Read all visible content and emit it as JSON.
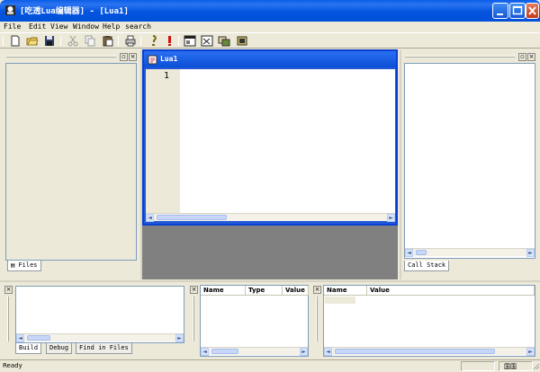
{
  "window": {
    "title": "[吃透Lua编辑器] - [Lua1]",
    "accent": "#0054e3",
    "close_color": "#c43a17"
  },
  "menu": [
    "File",
    "Edit",
    "View",
    "Window",
    "Help",
    "search"
  ],
  "toolbar": {
    "icons": [
      "new-file-icon",
      "open-folder-icon",
      "save-icon",
      "cut-icon",
      "copy-icon",
      "paste-icon",
      "print-icon",
      "compile-icon",
      "run-icon",
      "window-icon",
      "console-icon",
      "tools-icon",
      "settings-icon"
    ]
  },
  "editor": {
    "tab_title": "Lua1",
    "line_numbers": [
      "1"
    ]
  },
  "left_panel": {
    "tabs": [
      "Files"
    ]
  },
  "right_panel": {
    "tabs": [
      "Call Stack"
    ]
  },
  "output_panel": {
    "tabs": [
      "Build",
      "Debug",
      "Find in Files"
    ]
  },
  "watch_panel": {
    "columns": [
      "Name",
      "Type",
      "Value"
    ]
  },
  "locals_panel": {
    "columns": [
      "Name",
      "Value"
    ]
  },
  "status": {
    "text": "Ready",
    "indicator": "国国"
  }
}
